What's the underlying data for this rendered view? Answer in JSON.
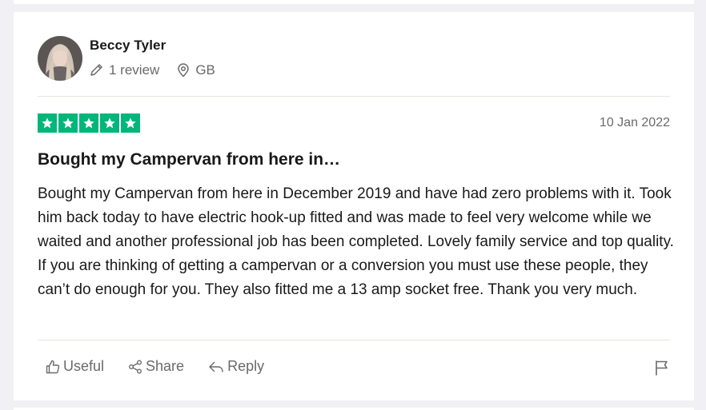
{
  "reviewer": {
    "name": "Beccy Tyler",
    "review_count": "1 review",
    "country": "GB"
  },
  "review": {
    "rating": 5,
    "rating_max": 5,
    "date": "10 Jan 2022",
    "title": "Bought my Campervan from here in…",
    "body": "Bought my Campervan from here in December 2019 and have had zero problems with it. Took him back today to have electric hook-up fitted and was made to feel very welcome while we waited and another professional job has been completed. Lovely family service and top quality. If you are thinking of getting a campervan or a conversion you must use these people, they can’t do enough for you. They also fitted me a 13 amp socket free. Thank you very much."
  },
  "actions": {
    "useful_label": "Useful",
    "share_label": "Share",
    "reply_label": "Reply"
  },
  "colors": {
    "star_green": "#00b67a",
    "muted_text": "#696a6a",
    "main_text": "#191919"
  },
  "icons": {
    "review_count": "pencil-icon",
    "country": "location-pin-icon",
    "useful": "thumbs-up-icon",
    "share": "share-icon",
    "reply": "reply-arrow-icon",
    "report": "flag-icon"
  }
}
